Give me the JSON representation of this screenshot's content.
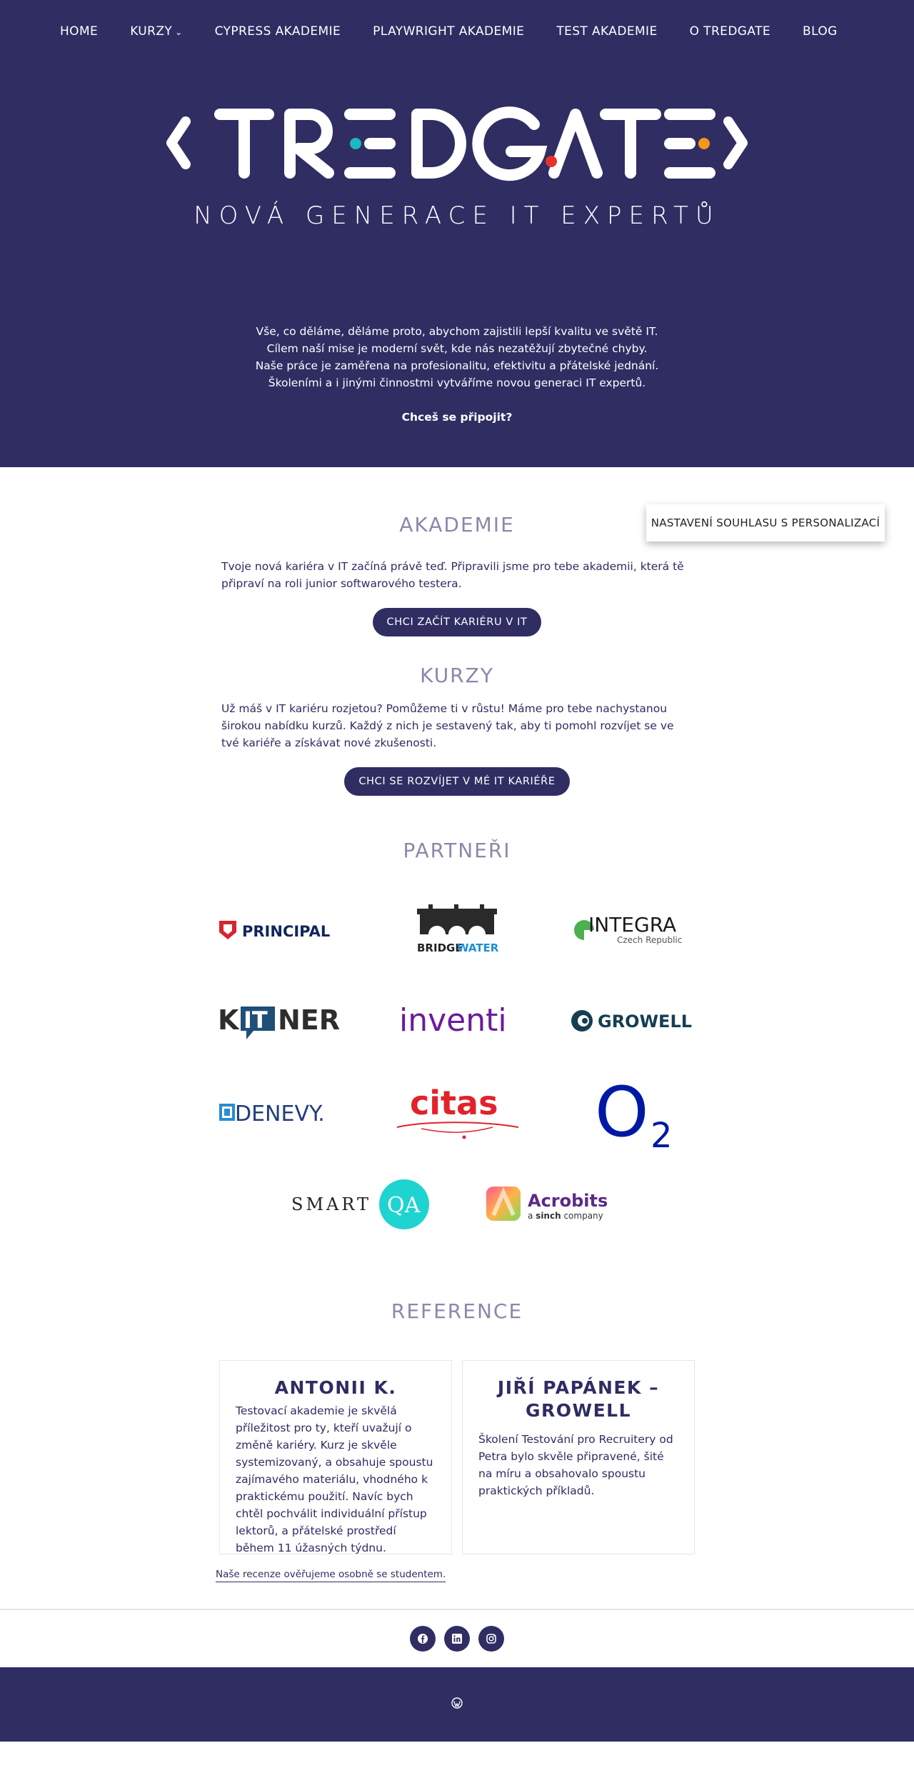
{
  "nav": {
    "items": [
      {
        "label": "HOME"
      },
      {
        "label": "KURZY",
        "dropdown": true
      },
      {
        "label": "CYPRESS AKADEMIE"
      },
      {
        "label": "PLAYWRIGHT AKADEMIE"
      },
      {
        "label": "TEST AKADEMIE"
      },
      {
        "label": "O TREDGATE"
      },
      {
        "label": "BLOG"
      }
    ]
  },
  "hero": {
    "logo_text": "TREDGATE",
    "tagline": "NOVÁ GENERACE IT EXPERTŮ",
    "mission_lines": [
      "Vše, co děláme, děláme proto, abychom zajistili lepší kvalitu ve světě IT.",
      "Cílem naší mise je moderní svět, kde nás nezatěžují zbytečné chyby.",
      "Naše práce je zaměřena na profesionalitu, efektivitu a přátelské jednání.",
      "Školeními a i jinými činnostmi vytváříme novou generaci IT expertů."
    ],
    "join": "Chceš se připojit?"
  },
  "consent_button": "NASTAVENÍ SOUHLASU S PERSONALIZACÍ",
  "akademie": {
    "title": "AKADEMIE",
    "text": "Tvoje nová kariéra v IT začíná právě teď. Připravili jsme pro tebe akademii, která tě připraví na roli junior softwarového testera.",
    "button": "CHCI ZAČÍT KARIÉRU V IT"
  },
  "kurzy": {
    "title": "KURZY",
    "text": "Už máš v IT kariéru rozjetou? Pomůžeme ti v růstu! Máme pro tebe nachystanou širokou nabídku kurzů. Každý z nich je sestavený tak, aby ti pomohl rozvíjet se ve tvé kariéře a získávat nové zkušenosti.",
    "button": "CHCI SE ROZVÍJET V MÉ IT KARIÉŘE"
  },
  "partners": {
    "title": "PARTNEŘI",
    "logos": {
      "principal": "PRINCIPAL",
      "bridgewater_1": "BRIDGE",
      "bridgewater_2": "WATER",
      "integra": "INTEGRA",
      "integra_sub": "Czech Republic",
      "kitner_1": "K",
      "kitner_2": "IT",
      "kitner_3": "NER",
      "inventi": "inventi",
      "growell": "GROWELL",
      "denevy": "DENEVY.",
      "citas": "citas",
      "o2_main": "O",
      "o2_sub": "2",
      "smartqa_1": "SMART",
      "smartqa_2": "QA",
      "acrobits": "Acrobits",
      "acrobits_sub_1": "a ",
      "acrobits_sub_2": "sinch",
      "acrobits_sub_3": " company"
    }
  },
  "reference": {
    "title": "REFERENCE",
    "cards": [
      {
        "name": "ANTONII K.",
        "text": "Testovací akademie je skvělá příležitost pro ty, kteří uvažují o změně kariéry. Kurz je skvěle systemizovaný, a obsahuje spoustu zajímavého materiálu, vhodného k praktickému použití. Navíc bych chtěl pochválit individuální přístup lektorů, a přátelské prostředí během 11 úžasných týdnu."
      },
      {
        "name": "JIŘÍ PAPÁNEK – GROWELL",
        "text": "Školení Testování pro Recruitery od Petra bylo skvěle připravené, šité na míru a obsahovalo spoustu praktických příkladů."
      }
    ],
    "note": "Naše recenze ověřujeme osobně se studentem."
  },
  "social": [
    "facebook-icon",
    "linkedin-icon",
    "instagram-icon"
  ],
  "footer": {
    "icon": "wordpress-icon"
  },
  "colors": {
    "brand": "#302d63",
    "title_muted": "#8b88ab",
    "teal": "#1cb8c0",
    "red": "#e5322d",
    "orange": "#f29a17"
  }
}
